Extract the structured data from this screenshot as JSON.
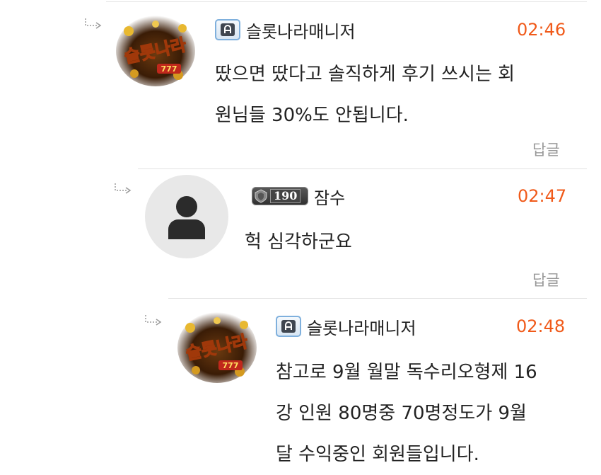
{
  "comments": [
    {
      "author": "슬롯나라매니저",
      "time": "02:46",
      "body_line1": "땄으면 땄다고 솔직하게 후기 쓰시는 회",
      "body_line2": "원님들 30%도 안됩니다.",
      "reply_label": "답글",
      "badge": "admin-badge-icon",
      "avatar_logo_text": "슬롯나라"
    },
    {
      "author": "잠수",
      "time": "02:47",
      "body_line1": "헉 심각하군요",
      "reply_label": "답글",
      "level": "190"
    },
    {
      "author": "슬롯나라매니저",
      "time": "02:48",
      "body_line1": "참고로 9월 월말 독수리오형제 16",
      "body_line2": "강 인원 80명중 70명정도가 9월",
      "body_line3": "달 수익중인 회원들입니다.",
      "badge": "admin-badge-icon",
      "avatar_logo_text": "슬롯나라"
    }
  ],
  "colors": {
    "time": "#f05a1a",
    "reply_link": "#9a9a9a",
    "divider": "#e3e3e3"
  }
}
